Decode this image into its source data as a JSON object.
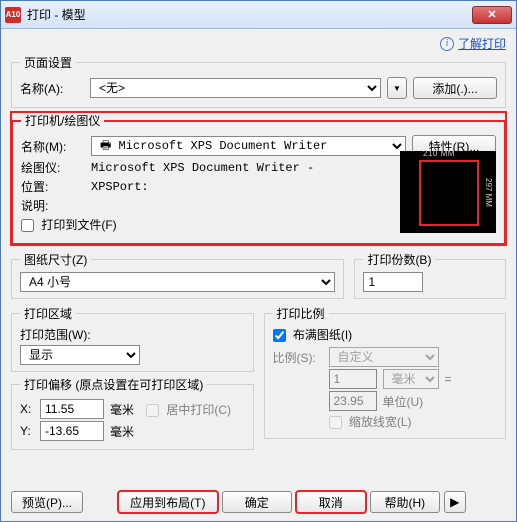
{
  "title": "打印 - 模型",
  "app_icon_text": "A10",
  "top_link": "了解打印",
  "page_setup": {
    "legend": "页面设置",
    "name_label": "名称(A):",
    "name_value": "<无>",
    "add_btn": "添加(.)..."
  },
  "printer": {
    "legend": "打印机/绘图仪",
    "name_label": "名称(M):",
    "name_value": "Microsoft XPS Document Writer",
    "props_btn": "特性(R)...",
    "plotter_label": "绘图仪:",
    "plotter_value": "Microsoft XPS Document Writer -",
    "location_label": "位置:",
    "location_value": "XPSPort:",
    "desc_label": "说明:",
    "print_to_file_label": "打印到文件(F)",
    "preview_width": "210 MM",
    "preview_height": "297 MM"
  },
  "paper": {
    "legend": "图纸尺寸(Z)",
    "value": "A4 小号"
  },
  "copies": {
    "legend": "打印份数(B)",
    "value": "1"
  },
  "area": {
    "legend": "打印区域",
    "range_label": "打印范围(W):",
    "range_value": "显示"
  },
  "scale": {
    "legend": "打印比例",
    "fit_label": "布满图纸(I)",
    "scale_label": "比例(S):",
    "scale_value": "自定义",
    "num_value": "1",
    "unit_value": "毫米",
    "eq": "=",
    "denom_value": "23.95",
    "unit2_label": "单位(U)",
    "lineweight_label": "缩放线宽(L)"
  },
  "offset": {
    "legend": "打印偏移 (原点设置在可打印区域)",
    "x_label": "X:",
    "x_value": "11.55",
    "x_unit": "毫米",
    "center_label": "居中打印(C)",
    "y_label": "Y:",
    "y_value": "-13.65",
    "y_unit": "毫米"
  },
  "footer": {
    "preview": "预览(P)...",
    "apply": "应用到布局(T)",
    "ok": "确定",
    "cancel": "取消",
    "help": "帮助(H)",
    "expand": "▶"
  }
}
